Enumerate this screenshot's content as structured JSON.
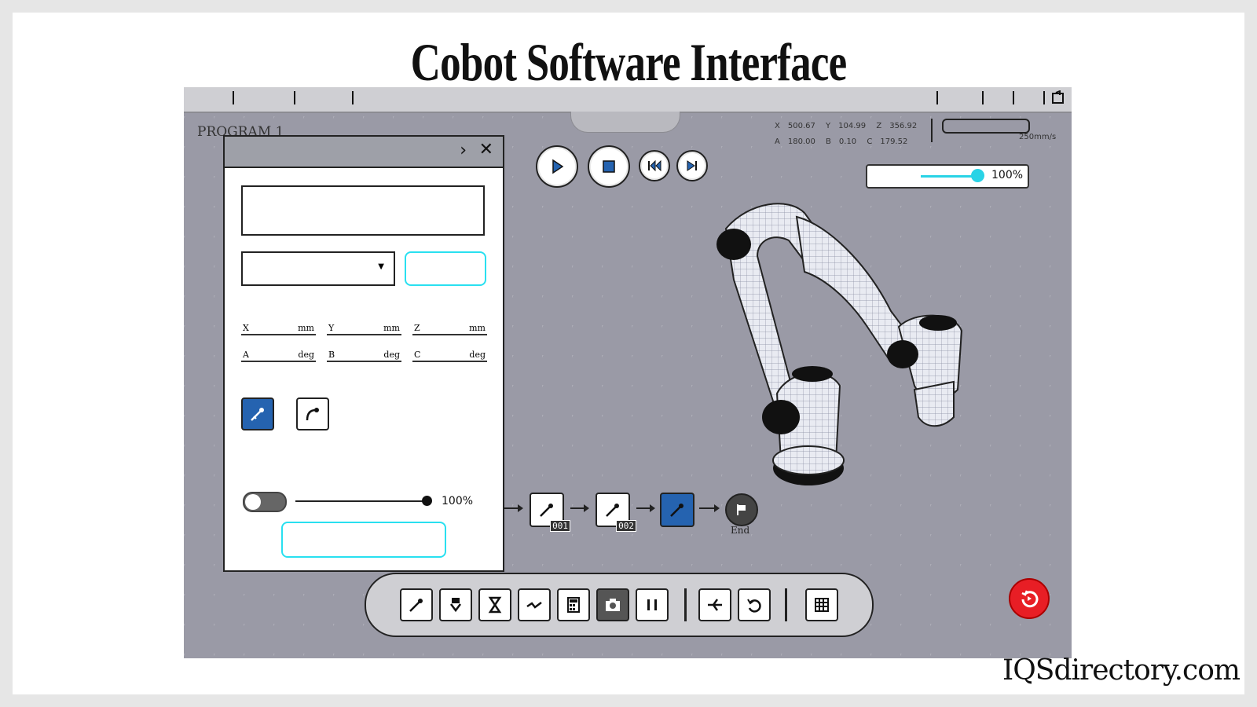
{
  "page": {
    "title": "Cobot Software Interface",
    "brand": "IQSdirectory.com"
  },
  "screen": {
    "program_label": "PROGRAM 1",
    "coords": {
      "x_label": "X",
      "x_value": "500.67",
      "y_label": "Y",
      "y_value": "104.99",
      "z_label": "Z",
      "z_value": "356.92",
      "a_label": "A",
      "a_value": "180.00",
      "b_label": "B",
      "b_value": "0.10",
      "c_label": "C",
      "c_value": "179.52"
    },
    "speed_label": "250mm/s",
    "override_percent": "100%",
    "controls": [
      "play-icon",
      "stop-icon",
      "skip-back-icon",
      "skip-forward-icon"
    ]
  },
  "panel": {
    "fields": {
      "x": "X",
      "y": "Y",
      "z": "Z",
      "a": "A",
      "b": "B",
      "c": "C",
      "mm": "mm",
      "deg": "deg"
    },
    "slider_percent": "100%"
  },
  "flow": {
    "nodes": [
      {
        "tag": "001"
      },
      {
        "tag": "002"
      }
    ],
    "end_label": "End"
  },
  "colors": {
    "accent_cyan": "#29e0f0",
    "active_blue": "#2563b0",
    "estop_red": "#e81e25"
  }
}
